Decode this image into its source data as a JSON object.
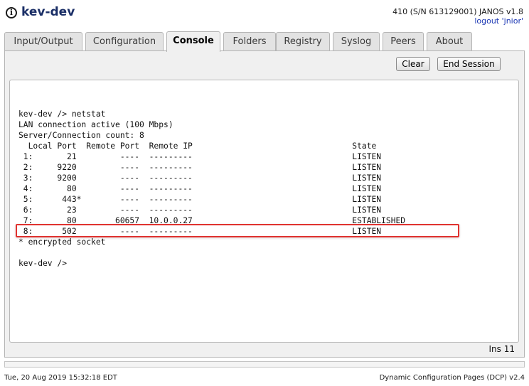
{
  "header": {
    "logo_glyph": "i",
    "title": "kev-dev",
    "device_info": "410 (S/N 613129001) JANOS v1.8",
    "logout": "logout 'jnior'"
  },
  "tabs": [
    {
      "label": "Input/Output",
      "active": false
    },
    {
      "label": "Configuration",
      "active": false
    },
    {
      "label": "Console",
      "active": true
    },
    {
      "label": "Folders",
      "active": false
    },
    {
      "label": "Registry",
      "active": false
    },
    {
      "label": "Syslog",
      "active": false
    },
    {
      "label": "Peers",
      "active": false
    },
    {
      "label": "About",
      "active": false
    }
  ],
  "console": {
    "clear_label": "Clear",
    "end_session_label": "End Session",
    "lines": [
      "kev-dev /> netstat",
      "LAN connection active (100 Mbps)",
      "Server/Connection count: 8",
      "  Local Port  Remote Port  Remote IP                                 State",
      " 1:       21         ----  ---------                                 LISTEN",
      " 2:     9220         ----  ---------                                 LISTEN",
      " 3:     9200         ----  ---------                                 LISTEN",
      " 4:       80         ----  ---------                                 LISTEN",
      " 5:      443*        ----  ---------                                 LISTEN",
      " 6:       23         ----  ---------                                 LISTEN",
      " 7:       80        60657  10.0.0.27                                 ESTABLISHED",
      " 8:      502         ----  ---------                                 LISTEN",
      "* encrypted socket",
      "",
      "kev-dev />"
    ],
    "status": "Ins 11"
  },
  "footer": {
    "timestamp": "Tue, 20 Aug 2019 15:32:18 EDT",
    "version": "Dynamic Configuration Pages (DCP) v2.4"
  },
  "colors": {
    "title": "#1a2e66",
    "link": "#1a36b3",
    "highlight_border": "#e0322f",
    "panel_bg": "#f0f0f0"
  }
}
